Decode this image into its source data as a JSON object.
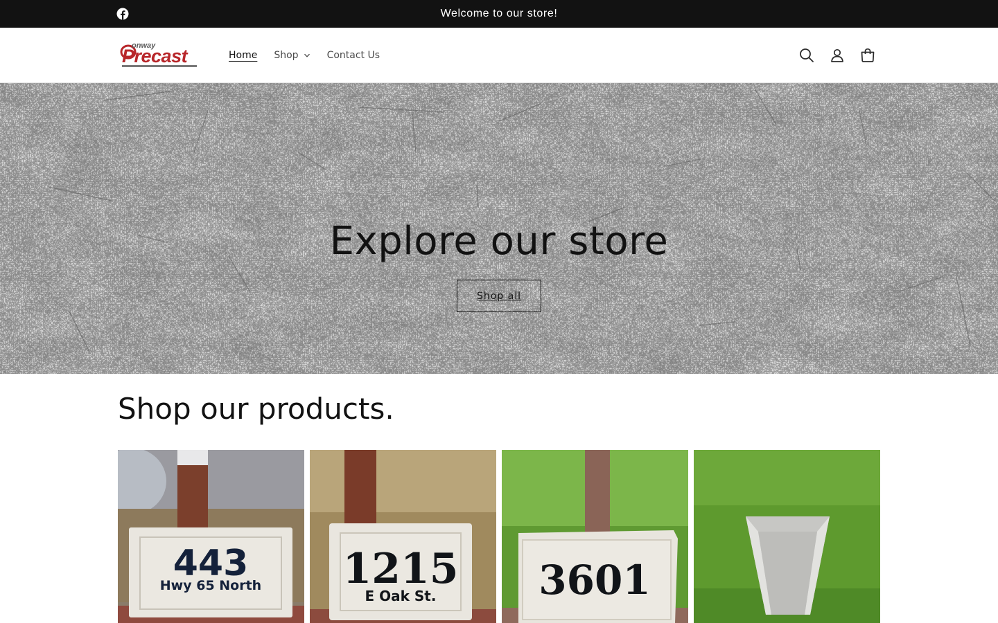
{
  "announcement": {
    "social_icon": "facebook-icon",
    "message": "Welcome to our store!"
  },
  "header": {
    "logo": {
      "small_text": "onway",
      "main_text": "Precast",
      "icon": "conway-precast-logo"
    },
    "nav": [
      {
        "label": "Home",
        "active": true
      },
      {
        "label": "Shop",
        "has_dropdown": true
      },
      {
        "label": "Contact Us"
      }
    ],
    "icons": [
      "search-icon",
      "account-icon",
      "cart-icon"
    ]
  },
  "hero": {
    "title": "Explore our store",
    "button_label": "Shop all"
  },
  "products": {
    "heading": "Shop our products.",
    "items": [
      {
        "number": "443",
        "subtext": "Hwy 65 North"
      },
      {
        "number": "1215",
        "subtext": "E Oak St."
      },
      {
        "number": "3601",
        "subtext": ""
      },
      {
        "number": "",
        "subtext": ""
      }
    ]
  },
  "colors": {
    "announcement_bg": "#121212",
    "text": "#121212",
    "logo_red": "#b8262a",
    "sign_text": "#14213a"
  }
}
